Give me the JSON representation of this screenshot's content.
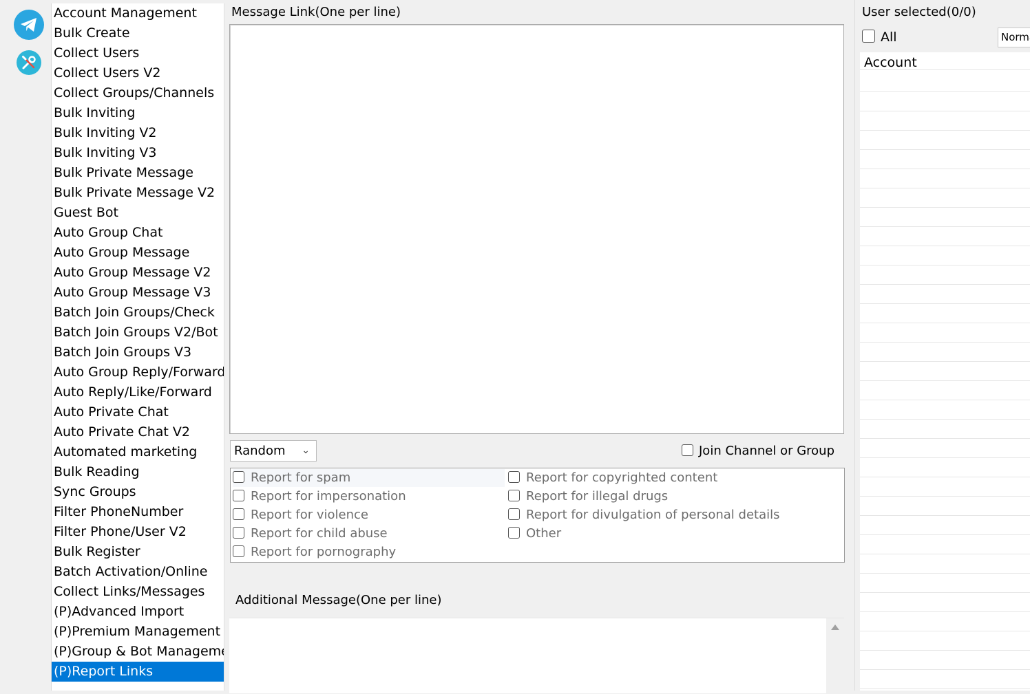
{
  "nav": {
    "items": [
      "Account Management",
      "Bulk Create",
      "Collect Users",
      "Collect Users V2",
      "Collect Groups/Channels",
      "Bulk Inviting",
      "Bulk Inviting V2",
      "Bulk Inviting V3",
      "Bulk Private Message",
      "Bulk Private Message V2",
      "Guest Bot",
      "Auto Group Chat",
      "Auto Group Message",
      "Auto Group Message V2",
      "Auto Group Message V3",
      "Batch Join Groups/Check",
      "Batch Join Groups V2/Bot",
      "Batch Join Groups V3",
      "Auto Group Reply/Forward",
      "Auto Reply/Like/Forward",
      "Auto Private Chat",
      "Auto Private Chat V2",
      "Automated marketing",
      "Bulk Reading",
      "Sync Groups",
      "Filter PhoneNumber",
      "Filter Phone/User V2",
      "Bulk Register",
      "Batch Activation/Online",
      "Collect Links/Messages",
      "(P)Advanced Import",
      "(P)Premium Management",
      "(P)Group & Bot Managemer",
      "(P)Report Links"
    ],
    "selected_index": 33
  },
  "main": {
    "message_link_label": "Message Link(One per line)",
    "mode_select_value": "Random",
    "join_label": "Join Channel or Group",
    "reasons_left": [
      "Report for spam",
      "Report for impersonation",
      "Report for violence",
      "Report for child abuse",
      "Report for pornography"
    ],
    "reasons_right": [
      "Report for copyrighted content",
      "Report for illegal drugs",
      "Report for divulgation of personal details",
      "Other"
    ],
    "additional_label": "Additional Message(One per line)"
  },
  "right": {
    "selected_label": "User selected(0/0)",
    "all_label": "All",
    "filter_value": "Normal",
    "column_header": "Account"
  },
  "colors": {
    "selection": "#0078d7",
    "telegram": "#2aa6e0",
    "tools": "#2db6d8"
  },
  "icons": [
    "telegram-icon",
    "tools-icon",
    "chevron-down-icon",
    "scroll-up-icon"
  ]
}
